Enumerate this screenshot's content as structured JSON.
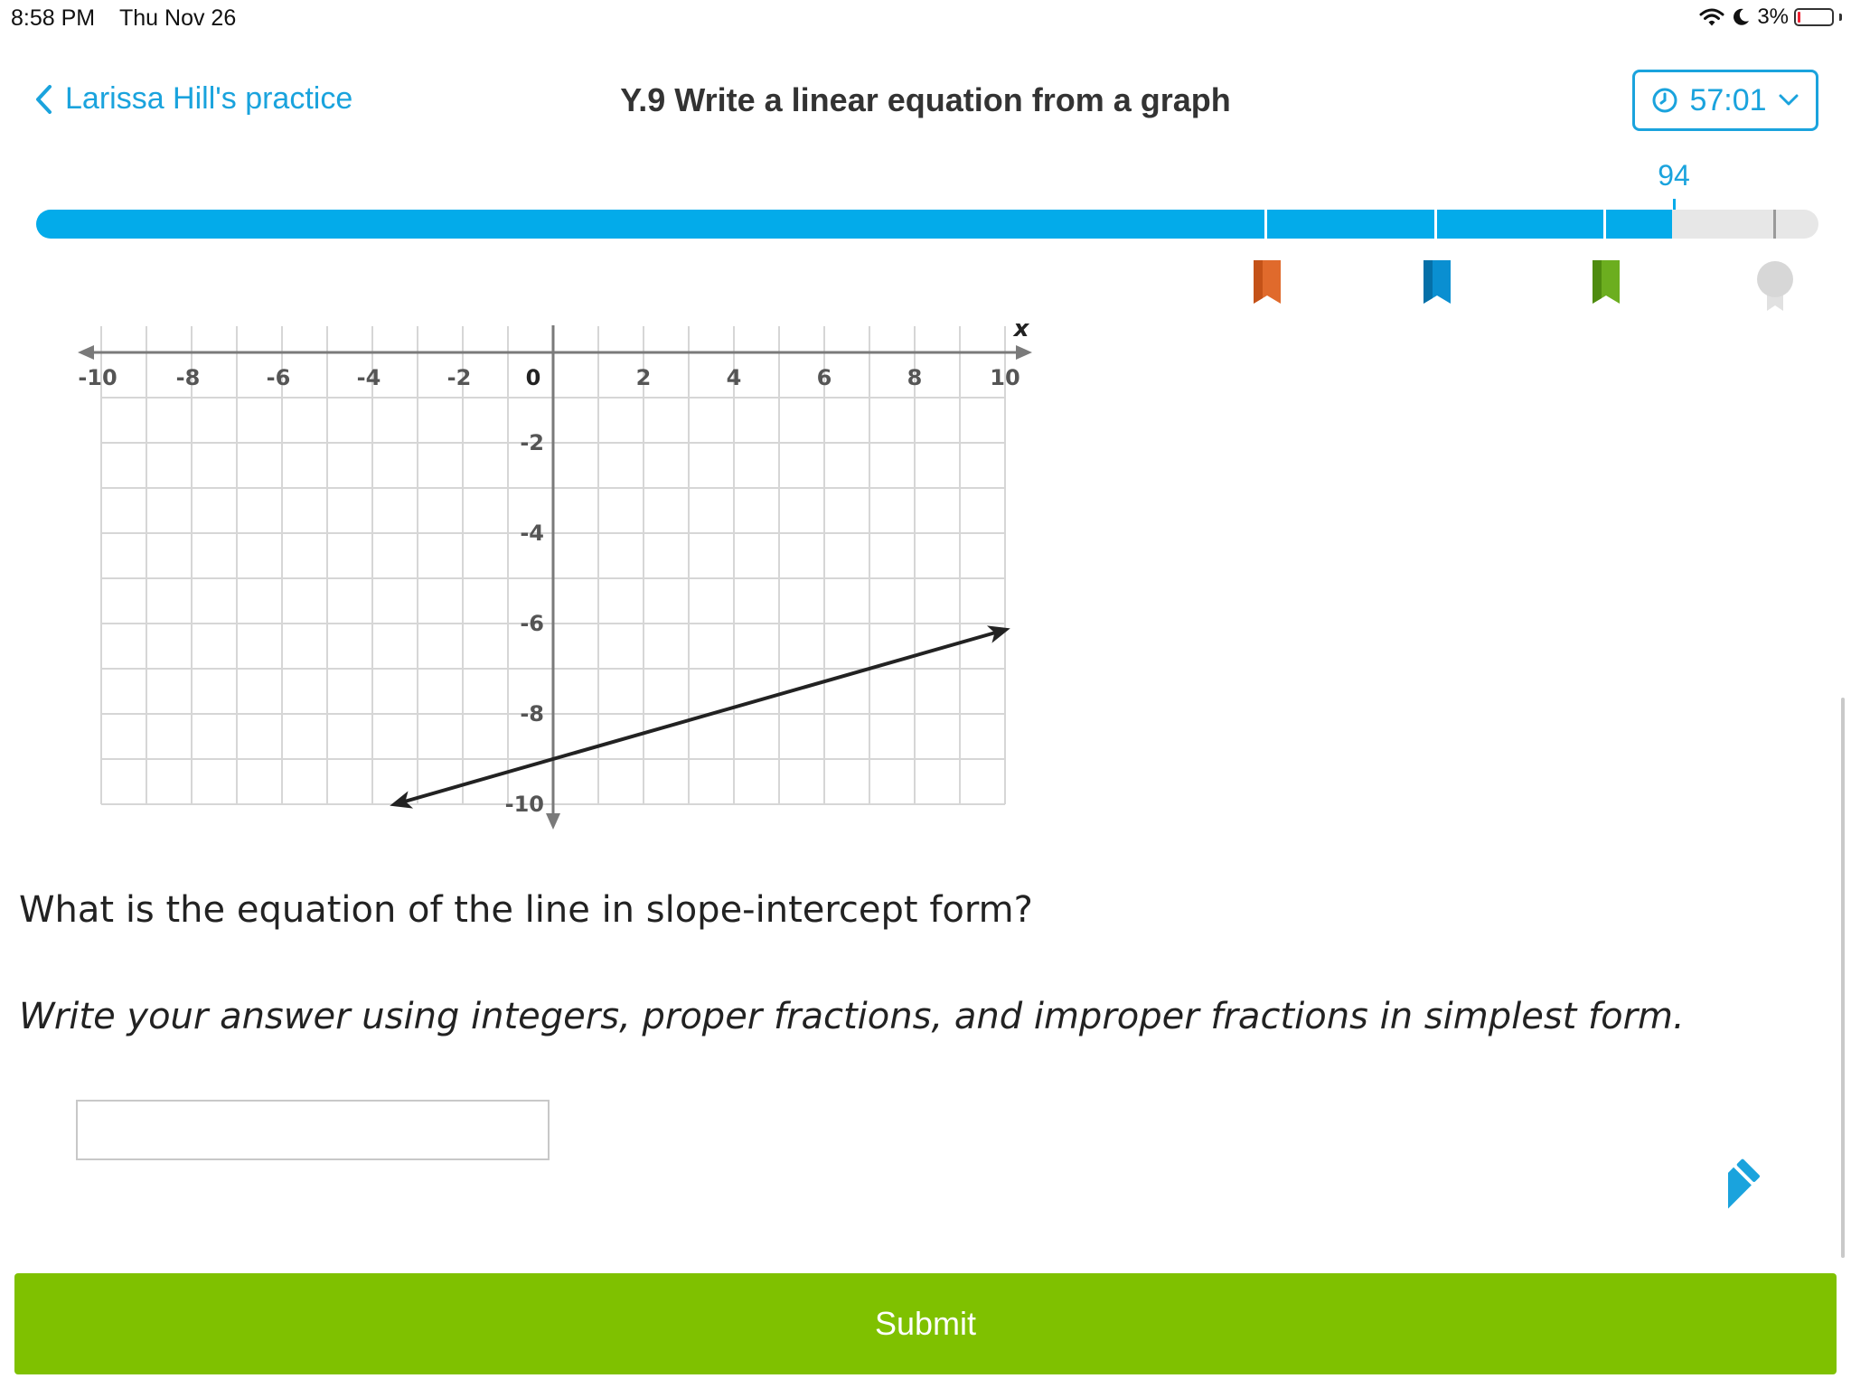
{
  "status_bar": {
    "time": "8:58 PM",
    "date": "Thu Nov 26",
    "battery": "3%"
  },
  "header": {
    "back_label": "Larissa Hill's practice",
    "title": "Y.9 Write a linear equation from a graph",
    "timer": "57:01"
  },
  "progress": {
    "score": "94",
    "score_value": 94,
    "awards": [
      {
        "name": "orange-ribbon",
        "color": "#e06a2c"
      },
      {
        "name": "blue-ribbon",
        "color": "#0a8fd1"
      },
      {
        "name": "green-ribbon",
        "color": "#6cae1f"
      },
      {
        "name": "gray-medal",
        "color": "#d7d7d7"
      }
    ]
  },
  "chart_data": {
    "type": "line",
    "x_label": "x",
    "xlim": [
      -10,
      10
    ],
    "ylim": [
      -10,
      0
    ],
    "x_ticks": [
      "-10",
      "-8",
      "-6",
      "-4",
      "-2",
      "2",
      "4",
      "6",
      "8",
      "10"
    ],
    "y_ticks": [
      "-2",
      "-4",
      "-6",
      "-8",
      "-10"
    ],
    "origin_label": "0",
    "grid": true,
    "line": {
      "x": [
        -3.5,
        10
      ],
      "y": [
        -10.0,
        -6.14
      ],
      "passes_through": [
        [
          0,
          -9
        ],
        [
          7,
          -7
        ]
      ]
    }
  },
  "question": {
    "prompt": "What is the equation of the line in slope-intercept form?",
    "instructions": "Write your answer using integers, proper fractions, and improper fractions in simplest form.",
    "answer_value": "",
    "answer_placeholder": ""
  },
  "submit_label": "Submit",
  "colors": {
    "accent": "#1aa3dd",
    "progress": "#03abea",
    "submit": "#7fc100"
  }
}
